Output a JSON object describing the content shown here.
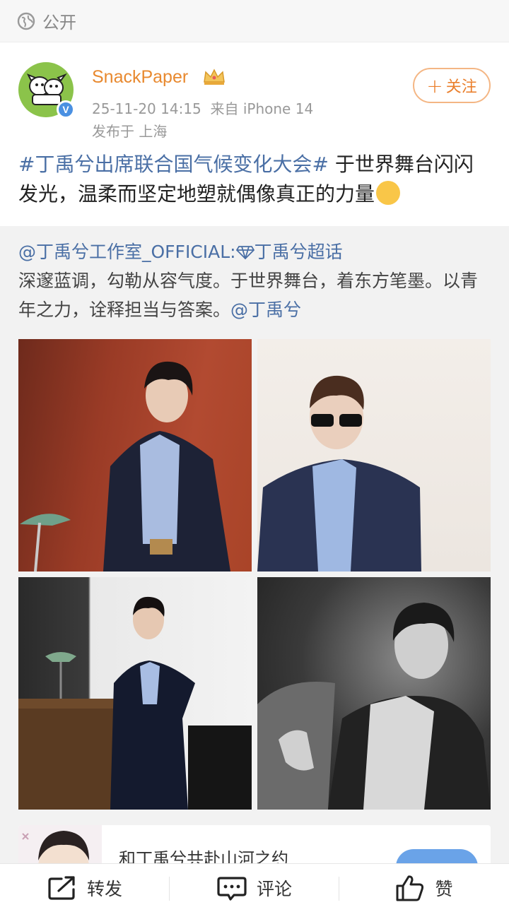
{
  "visibility": {
    "label": "公开",
    "icon": "globe-icon"
  },
  "author": {
    "name": "SnackPaper",
    "timestamp": "25-11-20 14:15",
    "source": "来自 iPhone 14",
    "location": "发布于 上海",
    "verified_badge": "V",
    "follow_label": "关注",
    "follow_plus": "+"
  },
  "post": {
    "hashtag": "#丁禹兮出席联合国气候变化大会#",
    "text": " 于世界舞台闪闪发光，温柔而坚定地塑就偶像真正的力量"
  },
  "repost": {
    "mention": "@丁禹兮工作室_OFFICIAL:",
    "supertopic": "丁禹兮超话",
    "text": "深邃蓝调，勾勒从容气度。于世界舞台，着东方笔墨。以青年之力，诠释担当与答案。",
    "mention_end": "@丁禹兮"
  },
  "card": {
    "title": "和丁禹兮共赴山河之约"
  },
  "actions": {
    "repost": "转发",
    "comment": "评论",
    "like": "赞"
  },
  "colors": {
    "link": "#4a6fa5",
    "username": "#e8892f",
    "follow": "#ea7f2c"
  }
}
